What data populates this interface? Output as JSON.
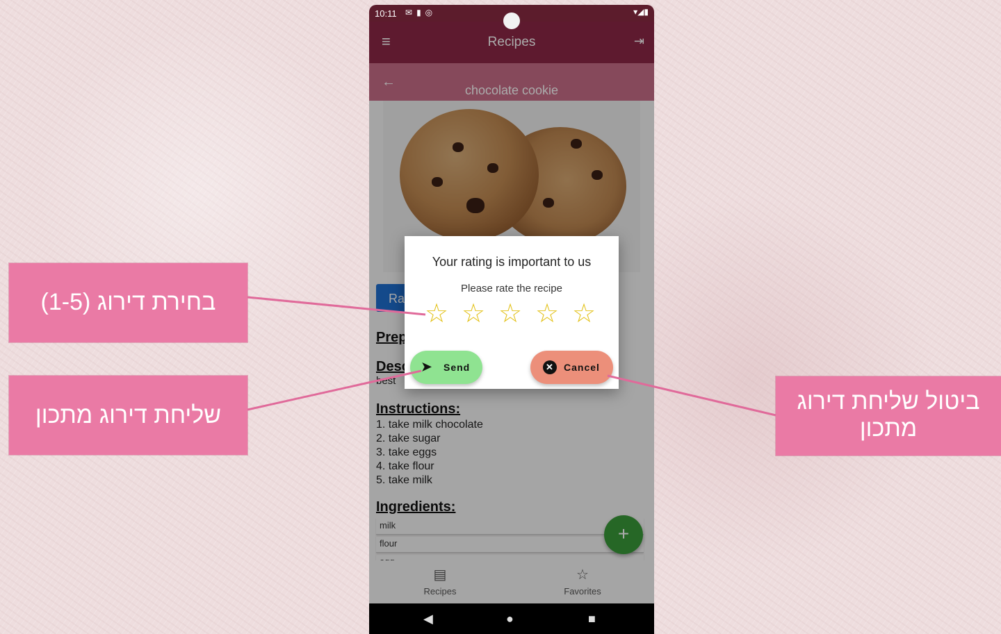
{
  "status_bar": {
    "time": "10:11",
    "icons": [
      "mail-icon",
      "sd-card-icon",
      "vpn-icon"
    ],
    "right_icons": [
      "wifi-icon",
      "signal-icon",
      "battery-icon"
    ]
  },
  "app_bar": {
    "title": "Recipes",
    "menu_icon": "hamburger-icon",
    "logout_icon": "logout-icon"
  },
  "recipe_header": {
    "title": "chocolate cookie",
    "back_icon": "arrow-left-icon"
  },
  "rate_button_label": "Ra",
  "sections": {
    "preparation_partial": "Prep",
    "description_partial": "Desc",
    "description_text_partial": "best",
    "instructions_title": "Instructions:",
    "instructions": [
      "1. take milk chocolate",
      "2. take sugar",
      "3. take eggs",
      "4. take flour",
      "5. take milk"
    ],
    "ingredients_title": "Ingredients:",
    "ingredients": [
      "milk",
      "flour",
      "egg"
    ]
  },
  "fab_label": "+",
  "bottom_nav": [
    {
      "label": "Recipes",
      "icon": "recipes-icon"
    },
    {
      "label": "Favorites",
      "icon": "star-outline-icon"
    }
  ],
  "system_nav": [
    "back",
    "home",
    "recents"
  ],
  "dialog": {
    "title": "Your rating is important to us",
    "subtitle": "Please rate the recipe",
    "stars_total": 5,
    "stars_selected": 0,
    "send_label": "Send",
    "cancel_label": "Cancel"
  },
  "callouts": {
    "rating_select": "בחירת דירוג (1-5)",
    "send_rating": "שליחת דירוג מתכון",
    "cancel_rating_line1": "ביטול שליחת דירוג",
    "cancel_rating_line2": "מתכון"
  },
  "colors": {
    "app_bar": "#8c2846",
    "status_bar": "#5c1c2c",
    "subbar": "#c86e88",
    "send_button": "#8fe391",
    "cancel_button": "#ec8f7a",
    "star": "#e3c21b",
    "fab": "#3a9a3a",
    "callout": "#ea7aa5",
    "connector": "#e06a9a"
  }
}
